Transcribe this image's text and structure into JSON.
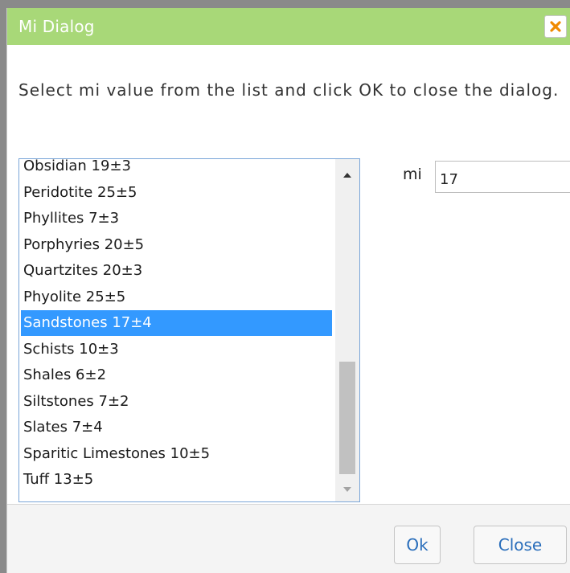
{
  "dialog": {
    "title": "Mi Dialog",
    "message": "Select mi value from the list and click OK to close the dialog."
  },
  "list": {
    "items": [
      "Obsidian 19±3",
      "Peridotite 25±5",
      "Phyllites 7±3",
      "Porphyries 20±5",
      "Quartzites 20±3",
      "Phyolite 25±5",
      "Sandstones 17±4",
      "Schists 10±3",
      "Shales 6±2",
      "Siltstones 7±2",
      "Slates 7±4",
      "Sparitic Limestones 10±5",
      "Tuff 13±5"
    ],
    "selected_index": 6
  },
  "mi": {
    "label": "mi",
    "value": "17"
  },
  "buttons": {
    "ok": "Ok",
    "close": "Close"
  },
  "colors": {
    "titlebar": "#a8d878",
    "selection": "#3399ff",
    "close_icon": "#f08a00",
    "button_text": "#2a6ebb"
  },
  "icons": {
    "close": "close-x-icon",
    "scroll_up": "triangle-up-icon",
    "scroll_down": "triangle-down-icon"
  }
}
